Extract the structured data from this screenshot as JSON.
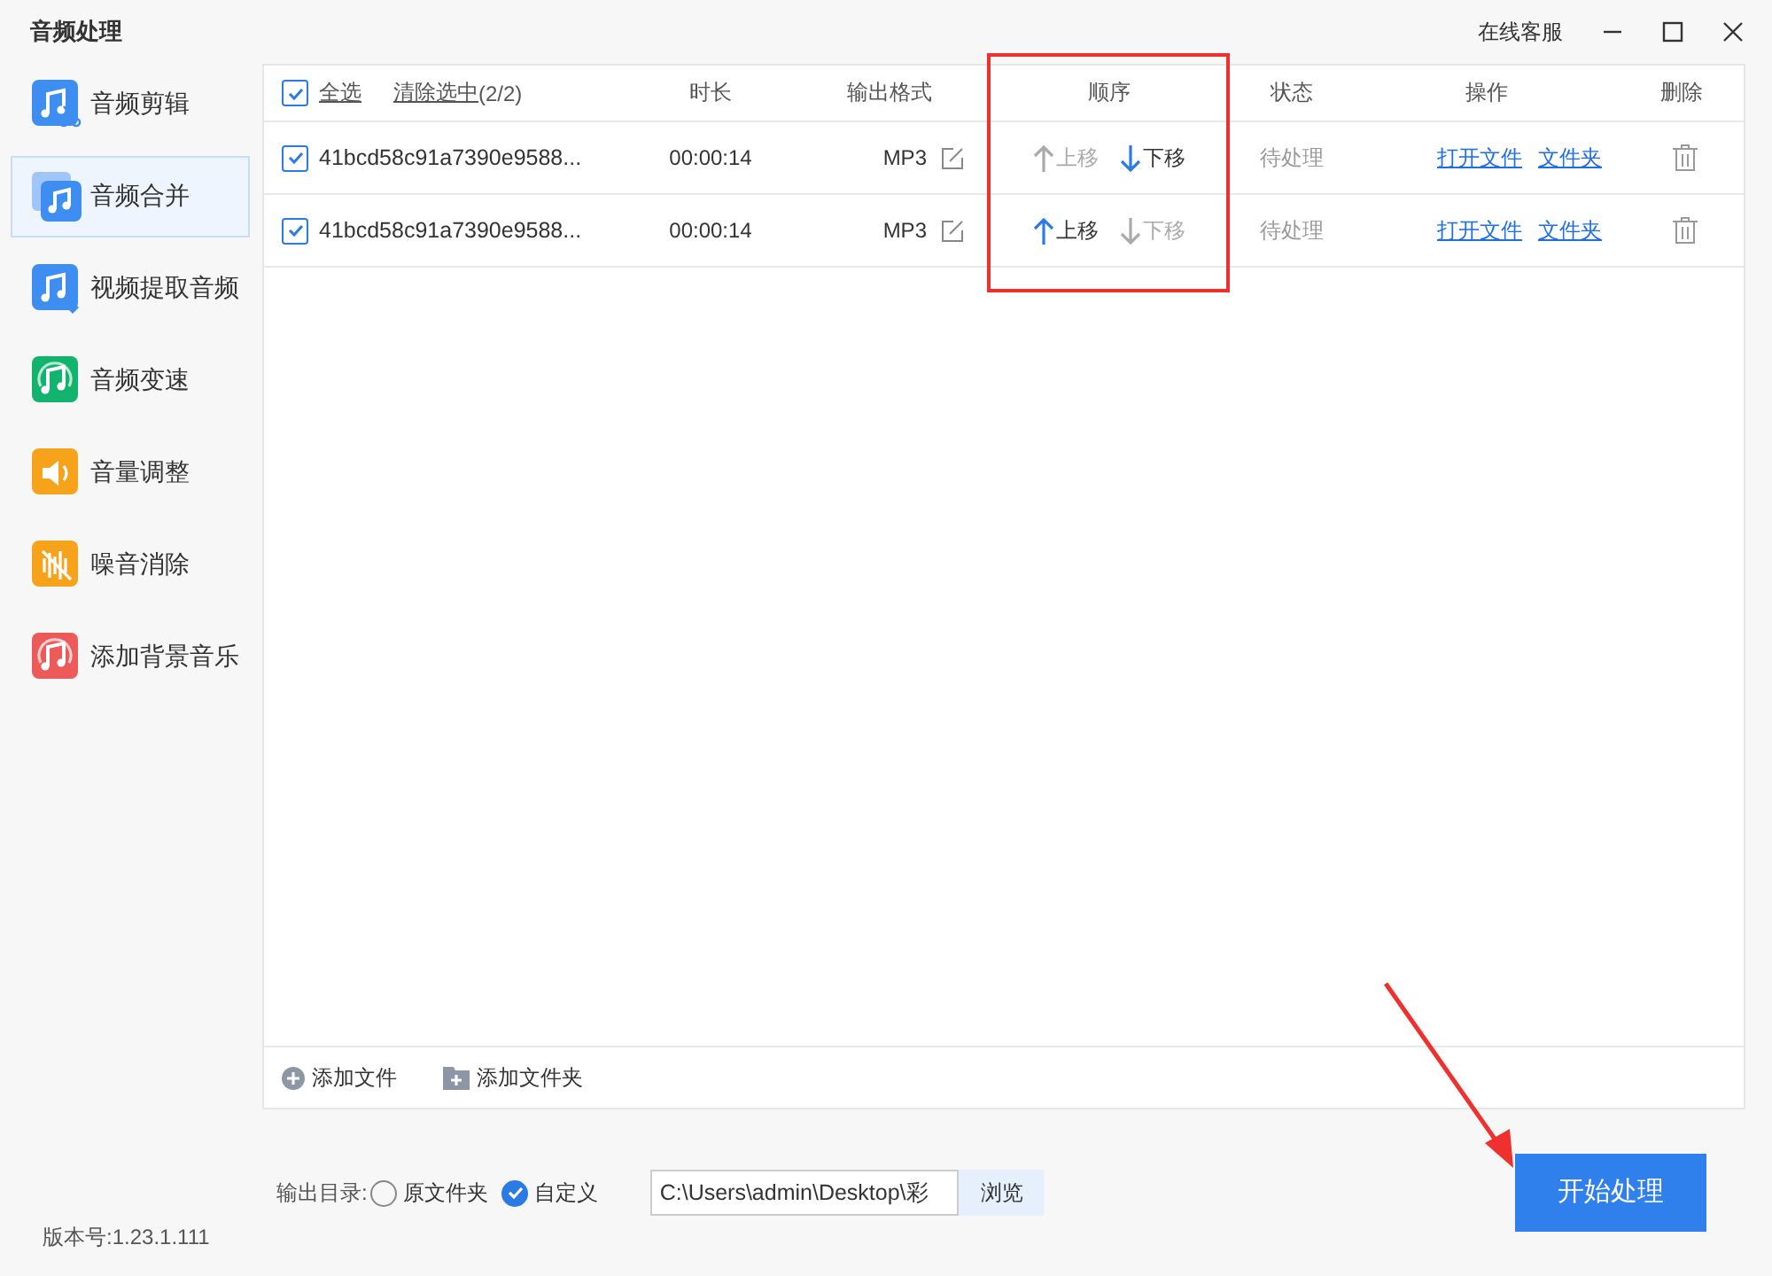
{
  "window": {
    "title": "音频处理",
    "support_link": "在线客服"
  },
  "sidebar": {
    "items": [
      {
        "label": "音频剪辑",
        "kind": "cut",
        "color": "#3d8ef0",
        "selected": false
      },
      {
        "label": "音频合并",
        "kind": "merge",
        "color": "#3d8ef0",
        "selected": true
      },
      {
        "label": "视频提取音频",
        "kind": "extract",
        "color": "#3d8ef0",
        "selected": false
      },
      {
        "label": "音频变速",
        "kind": "speed",
        "color": "#12b36c",
        "selected": false
      },
      {
        "label": "音量调整",
        "kind": "volume",
        "color": "#f7a21b",
        "selected": false
      },
      {
        "label": "噪音消除",
        "kind": "noise",
        "color": "#f7a21b",
        "selected": false
      },
      {
        "label": "添加背景音乐",
        "kind": "bgm",
        "color": "#ec5a5a",
        "selected": false
      }
    ]
  },
  "table": {
    "select_all": {
      "label": "全选",
      "checked": true
    },
    "clear_selection": "清除选中",
    "count": "(2/2)",
    "columns": [
      "时长",
      "输出格式",
      "顺序",
      "状态",
      "操作",
      "删除"
    ],
    "rows": [
      {
        "checked": true,
        "name": "41bcd58c91a7390e9588...",
        "duration": "00:00:14",
        "format": "MP3",
        "up": {
          "label": "上移",
          "disabled": true
        },
        "down": {
          "label": "下移",
          "disabled": false
        },
        "status": "待处理",
        "actions": [
          "打开文件",
          "文件夹"
        ]
      },
      {
        "checked": true,
        "name": "41bcd58c91a7390e9588...",
        "duration": "00:00:14",
        "format": "MP3",
        "up": {
          "label": "上移",
          "disabled": false
        },
        "down": {
          "label": "下移",
          "disabled": true
        },
        "status": "待处理",
        "actions": [
          "打开文件",
          "文件夹"
        ]
      }
    ],
    "add_file": "添加文件",
    "add_folder": "添加文件夹"
  },
  "output_dir": {
    "label": "输出目录:",
    "options": [
      {
        "label": "原文件夹",
        "selected": false
      },
      {
        "label": "自定义",
        "selected": true
      }
    ],
    "path": "C:\\Users\\admin\\Desktop\\彩",
    "browse": "浏览"
  },
  "start_button": "开始处理",
  "version": "版本号:1.23.1.111"
}
